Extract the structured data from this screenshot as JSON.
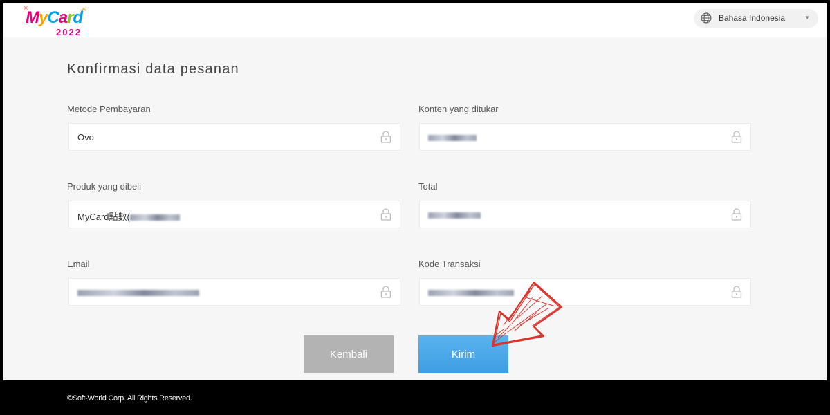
{
  "header": {
    "logo": {
      "brand": "MyCard",
      "year": "2022"
    },
    "language": {
      "label": "Bahasa Indonesia"
    }
  },
  "page": {
    "title": "Konfirmasi data pesanan"
  },
  "fields": {
    "payment_method": {
      "label": "Metode Pembayaran",
      "value": "Ovo"
    },
    "content": {
      "label": "Konten yang ditukar"
    },
    "product": {
      "label": "Produk yang dibeli",
      "value_prefix": "MyCard點數("
    },
    "total": {
      "label": "Total"
    },
    "email": {
      "label": "Email"
    },
    "transaction_code": {
      "label": "Kode Transaksi"
    }
  },
  "buttons": {
    "back": "Kembali",
    "submit": "Kirim"
  },
  "footer": {
    "copyright": "©Soft-World Corp. All Rights Reserved."
  },
  "colors": {
    "submit": "#4aa8ea",
    "back": "#b3b3b3",
    "annotation_arrow": "#d9342b"
  },
  "icons": [
    "globe-icon",
    "chevron-down-icon",
    "lock-icon",
    "arrow-annotation"
  ]
}
